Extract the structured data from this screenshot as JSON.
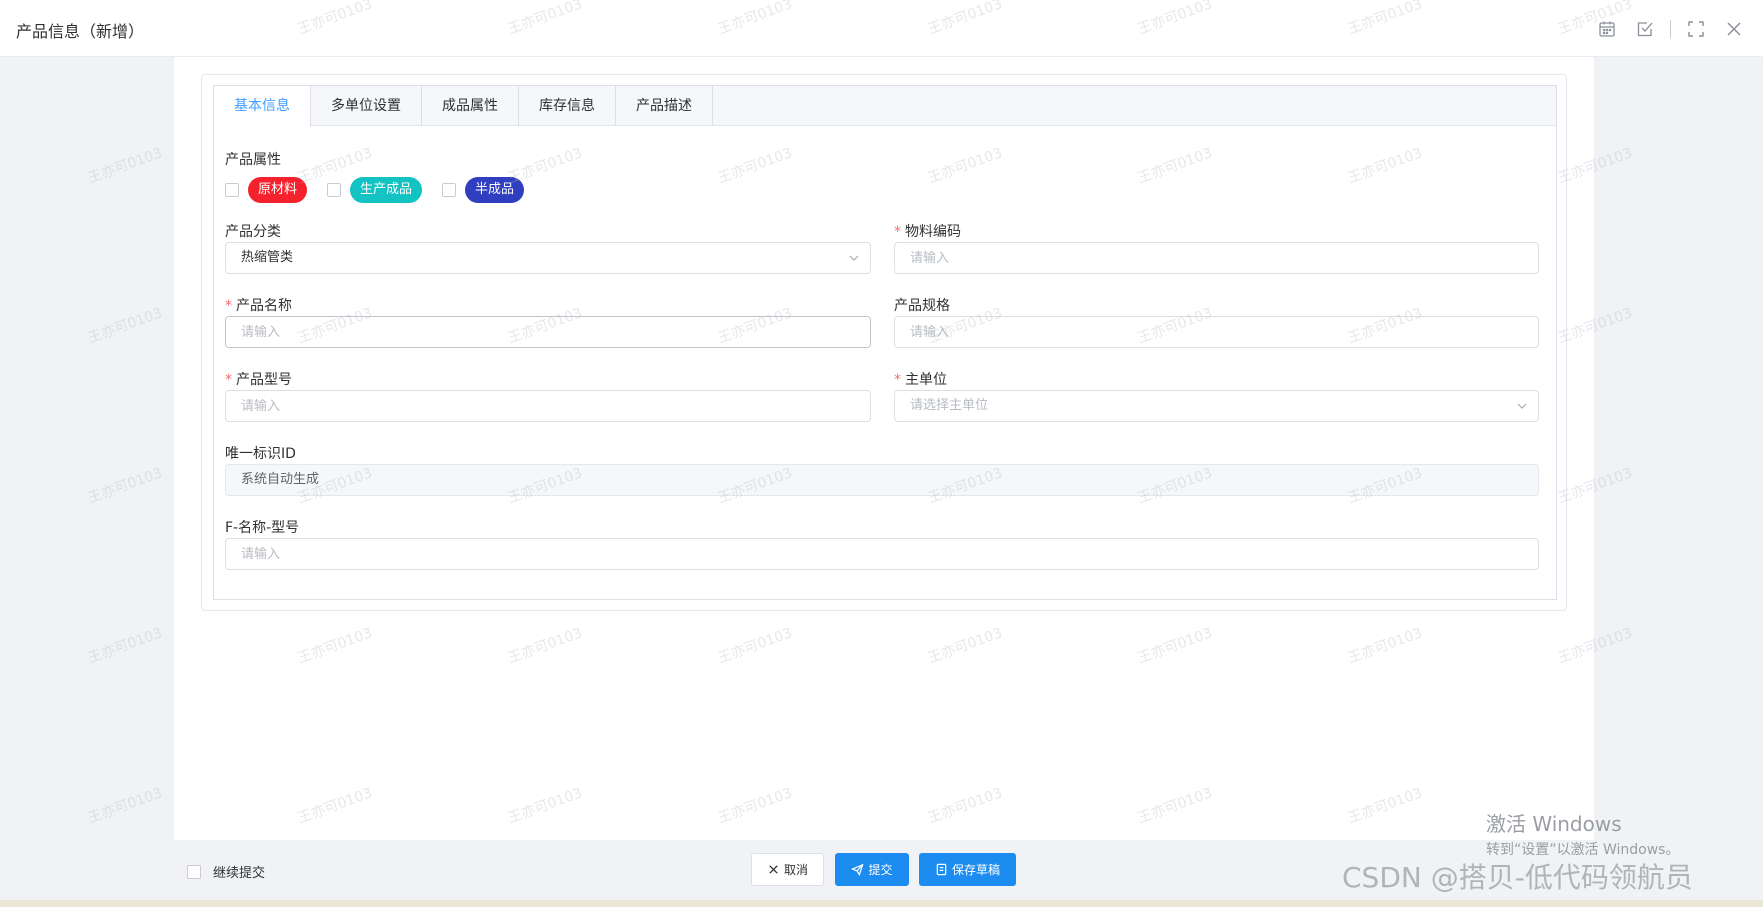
{
  "window": {
    "title": "产品信息（新增）",
    "tool_icons": [
      "calendar-icon",
      "checkbox-icon",
      "fullscreen-icon",
      "close-icon"
    ]
  },
  "tabs": [
    {
      "label": "基本信息",
      "active": true
    },
    {
      "label": "多单位设置",
      "active": false
    },
    {
      "label": "成品属性",
      "active": false
    },
    {
      "label": "库存信息",
      "active": false
    },
    {
      "label": "产品描述",
      "active": false
    }
  ],
  "form": {
    "product_attr": {
      "label": "产品属性",
      "options": [
        {
          "label": "原材料",
          "color": "#f5222d",
          "checked": false
        },
        {
          "label": "生产成品",
          "color": "#13c2c2",
          "checked": false
        },
        {
          "label": "半成品",
          "color": "#2f3fbf",
          "checked": false
        }
      ]
    },
    "category": {
      "label": "产品分类",
      "value": "热缩管类"
    },
    "material_code": {
      "label": "物料编码",
      "required": true,
      "placeholder": "请输入"
    },
    "product_name": {
      "label": "产品名称",
      "required": true,
      "placeholder": "请输入"
    },
    "product_spec": {
      "label": "产品规格",
      "placeholder": "请输入"
    },
    "product_model": {
      "label": "产品型号",
      "required": true,
      "placeholder": "请输入"
    },
    "main_unit": {
      "label": "主单位",
      "required": true,
      "placeholder": "请选择主单位"
    },
    "unique_id": {
      "label": "唯一标识ID",
      "value": "系统自动生成"
    },
    "f_name_model": {
      "label": "F-名称-型号",
      "placeholder": "请输入"
    }
  },
  "footer": {
    "continue_submit": "继续提交",
    "cancel": "取消",
    "submit": "提交",
    "save_draft": "保存草稿"
  },
  "watermark": "王亦可0103",
  "os_overlay": {
    "line1": "激活 Windows",
    "line2": "转到“设置”以激活 Windows。",
    "csdn": "CSDN @搭贝-低代码领航员"
  }
}
